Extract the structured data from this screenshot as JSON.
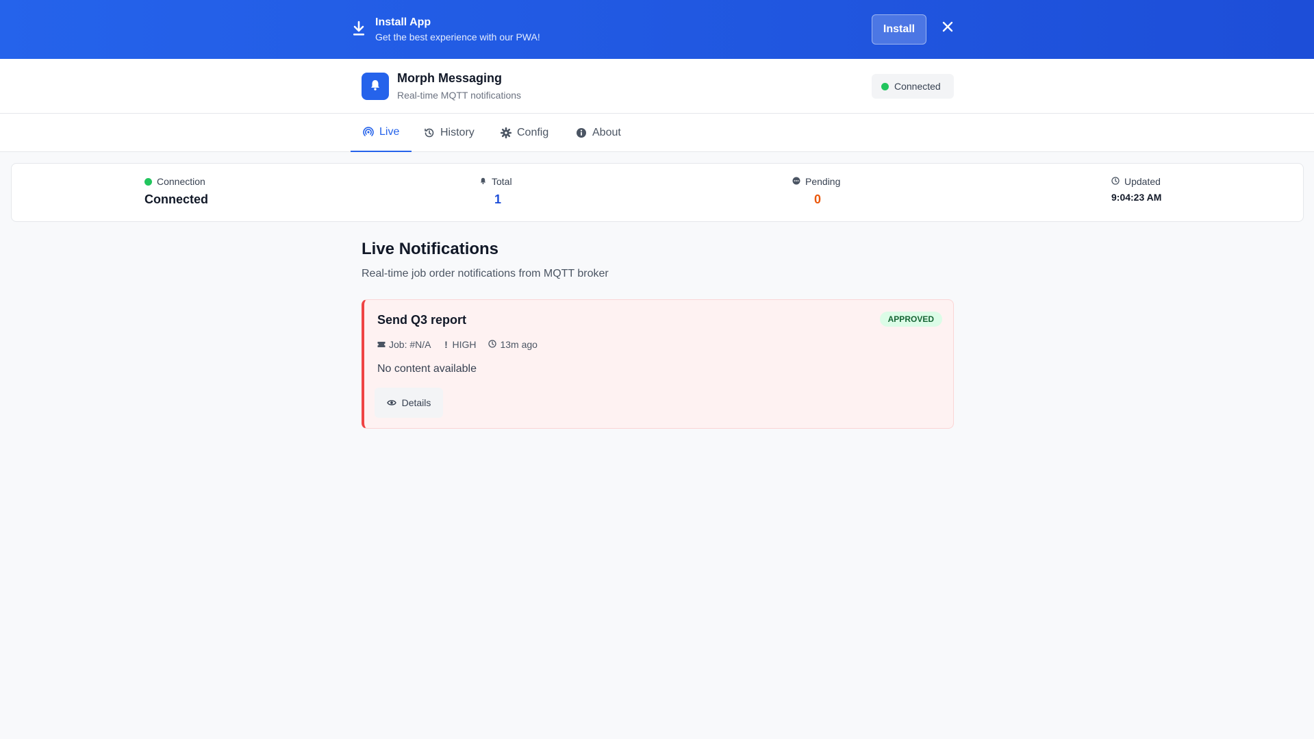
{
  "banner": {
    "title": "Install App",
    "subtitle": "Get the best experience with our PWA!",
    "install_label": "Install",
    "icon": "download-icon",
    "close_icon": "close-icon"
  },
  "header": {
    "app_name": "Morph Messaging",
    "app_subtitle": "Real-time MQTT notifications",
    "logo_icon": "bell-icon",
    "status": "Connected",
    "status_color": "#22c55e"
  },
  "tabs": [
    {
      "label": "Live",
      "icon": "broadcast-icon",
      "active": true
    },
    {
      "label": "History",
      "icon": "history-icon",
      "active": false
    },
    {
      "label": "Config",
      "icon": "gear-icon",
      "active": false
    },
    {
      "label": "About",
      "icon": "info-icon",
      "active": false
    }
  ],
  "stats": {
    "connection": {
      "label": "Connection",
      "value": "Connected",
      "icon": "status-dot-icon"
    },
    "total": {
      "label": "Total",
      "value": "1",
      "icon": "bell-icon",
      "color": "#1d4ed8"
    },
    "pending": {
      "label": "Pending",
      "value": "0",
      "icon": "pending-icon",
      "color": "#ea580c"
    },
    "updated": {
      "label": "Updated",
      "value": "9:04:23 AM",
      "icon": "clock-icon"
    }
  },
  "main": {
    "title": "Live Notifications",
    "subtitle": "Real-time job order notifications from MQTT broker"
  },
  "notifications": [
    {
      "title": "Send Q3 report",
      "status": "APPROVED",
      "job": "Job: #N/A",
      "priority": "HIGH",
      "time": "13m ago",
      "content": "No content available",
      "details_label": "Details",
      "accent": "#ef4444"
    }
  ],
  "colors": {
    "primary": "#2563eb",
    "background": "#f8f9fb",
    "success": "#22c55e"
  }
}
